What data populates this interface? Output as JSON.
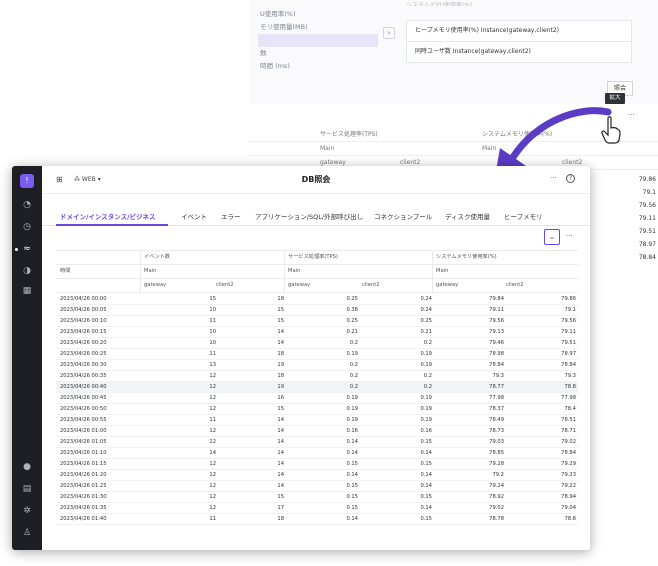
{
  "background": {
    "top_partial": "システム/CPU使用率(%)",
    "list_items": [
      "U使用率(%)",
      "モリ使用量(MB)",
      "",
      "数",
      "時間 (ms)"
    ],
    "chips": [
      "ヒープメモリ使用率(%) Instance(gateway,client2)",
      "同時ユーザ数 Instance(gateway,client2)"
    ],
    "inquiry_button": "照会",
    "tooltip": "拡大",
    "more": "···",
    "table_head": {
      "tps": "サービス処理率(TPS)",
      "sys_mem": "システムメモリ使用率(%)",
      "main": "Main",
      "gateway": "gateway",
      "client2": "client2"
    },
    "side_values": [
      "79.86",
      "79.1",
      "79.56",
      "79.11",
      "79.51",
      "78.97",
      "78.84"
    ]
  },
  "window": {
    "service": "WEB",
    "title": "DB照会",
    "more": "···",
    "help": "?",
    "tabs": [
      "ドメイン/インスタンス/ビジネス",
      "イベント",
      "エラー",
      "アプリケーション/SQL/外部呼び出し",
      "コネクションプール",
      "ディスク使用量",
      "ヒープメモリ"
    ],
    "table": {
      "time_header": "時間",
      "groups": [
        "イベント数",
        "サービス処理率(TPS)",
        "システムメモリ使用率(%)"
      ],
      "main": "Main",
      "gateway": "gateway",
      "client2": "client2",
      "rows": [
        [
          "2023/04/26 00:00",
          "15",
          "18",
          "0.25",
          "0.24",
          "79.84",
          "79.86"
        ],
        [
          "2023/04/26 00:05",
          "10",
          "15",
          "0.38",
          "0.24",
          "79.11",
          "79.1"
        ],
        [
          "2023/04/26 00:10",
          "11",
          "15",
          "0.25",
          "0.25",
          "79.56",
          "79.56"
        ],
        [
          "2023/04/26 00:15",
          "10",
          "14",
          "0.21",
          "0.21",
          "79.13",
          "79.11"
        ],
        [
          "2023/04/26 00:20",
          "10",
          "14",
          "0.2",
          "0.2",
          "79.46",
          "79.51"
        ],
        [
          "2023/04/26 00:25",
          "11",
          "18",
          "0.19",
          "0.19",
          "78.98",
          "78.97"
        ],
        [
          "2023/04/26 00:30",
          "13",
          "19",
          "0.2",
          "0.19",
          "78.84",
          "78.84"
        ],
        [
          "2023/04/26 00:35",
          "12",
          "18",
          "0.2",
          "0.2",
          "79.3",
          "79.3"
        ],
        [
          "2023/04/26 00:40",
          "12",
          "19",
          "0.2",
          "0.2",
          "78.77",
          "78.8"
        ],
        [
          "2023/04/26 00:45",
          "12",
          "16",
          "0.19",
          "0.19",
          "77.98",
          "77.98"
        ],
        [
          "2023/04/26 00:50",
          "12",
          "15",
          "0.19",
          "0.19",
          "78.37",
          "78.4"
        ],
        [
          "2023/04/26 00:55",
          "11",
          "14",
          "0.19",
          "0.19",
          "78.49",
          "78.51"
        ],
        [
          "2023/04/26 01:00",
          "12",
          "14",
          "0.16",
          "0.16",
          "78.73",
          "78.71"
        ],
        [
          "2023/04/26 01:05",
          "12",
          "14",
          "0.14",
          "0.15",
          "79.03",
          "79.02"
        ],
        [
          "2023/04/26 01:10",
          "14",
          "14",
          "0.14",
          "0.14",
          "78.85",
          "78.84"
        ],
        [
          "2023/04/26 01:15",
          "12",
          "14",
          "0.15",
          "0.15",
          "79.28",
          "79.29"
        ],
        [
          "2023/04/26 01:20",
          "12",
          "14",
          "0.14",
          "0.14",
          "79.2",
          "79.23"
        ],
        [
          "2023/04/26 01:25",
          "12",
          "14",
          "0.15",
          "0.14",
          "79.24",
          "79.22"
        ],
        [
          "2023/04/26 01:30",
          "12",
          "15",
          "0.15",
          "0.15",
          "78.92",
          "78.94"
        ],
        [
          "2023/04/26 01:35",
          "12",
          "17",
          "0.15",
          "0.14",
          "79.02",
          "79.04"
        ],
        [
          "2023/04/26 01:40",
          "11",
          "18",
          "0.14",
          "0.15",
          "78.78",
          "78.8"
        ]
      ],
      "highlighted_row": 8
    }
  },
  "colors": {
    "accent": "#6a45e0",
    "sidebar": "#1d1f24",
    "arrow": "#5b3cc4"
  }
}
